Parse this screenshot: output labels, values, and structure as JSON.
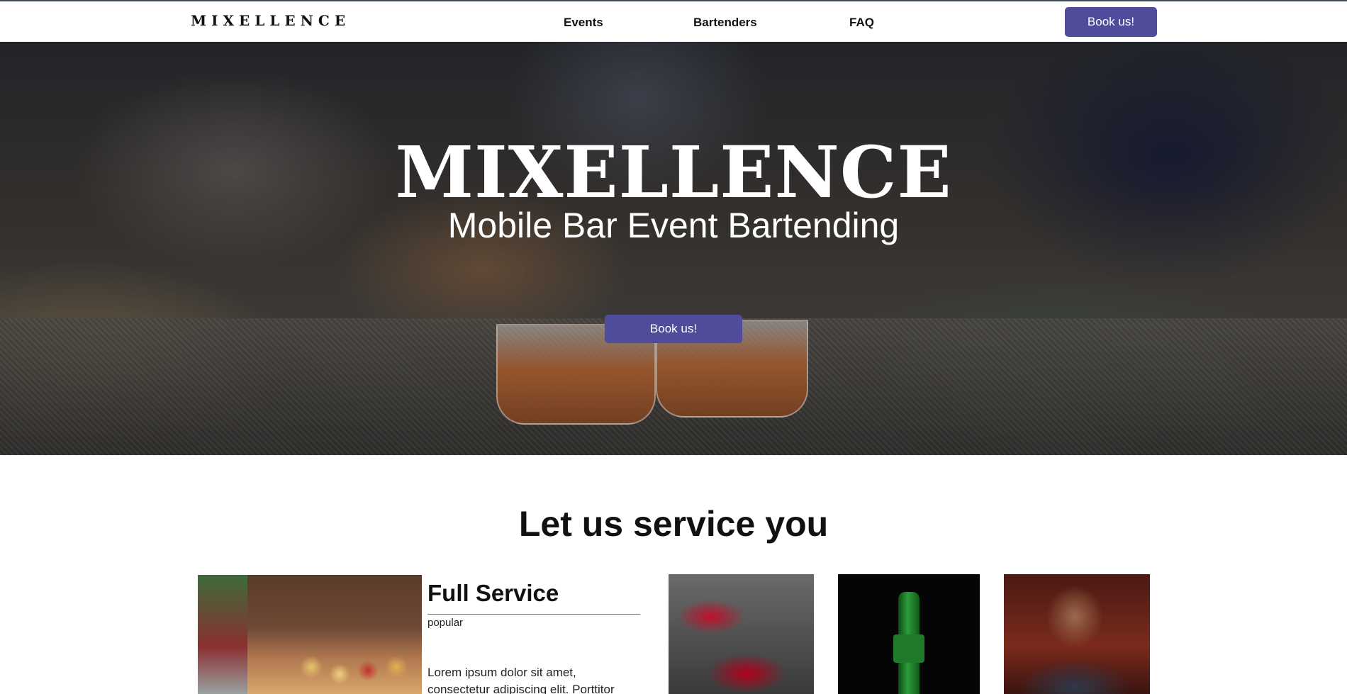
{
  "nav": {
    "logo": "MIXELLENCE",
    "links": [
      "Events",
      "Bartenders",
      "FAQ"
    ],
    "book_label": "Book us!"
  },
  "hero": {
    "title": "MIXELLENCE",
    "subtitle": "Mobile Bar Event Bartending",
    "book_label": "Book us!"
  },
  "services": {
    "heading": "Let us service you",
    "featured": {
      "title": "Full Service",
      "tag": "popular",
      "description": "Lorem ipsum dolor sit amet, consectetur adipiscing elit. Porttitor"
    }
  },
  "colors": {
    "accent": "#4f4c9c",
    "topline": "#3c4a57"
  }
}
